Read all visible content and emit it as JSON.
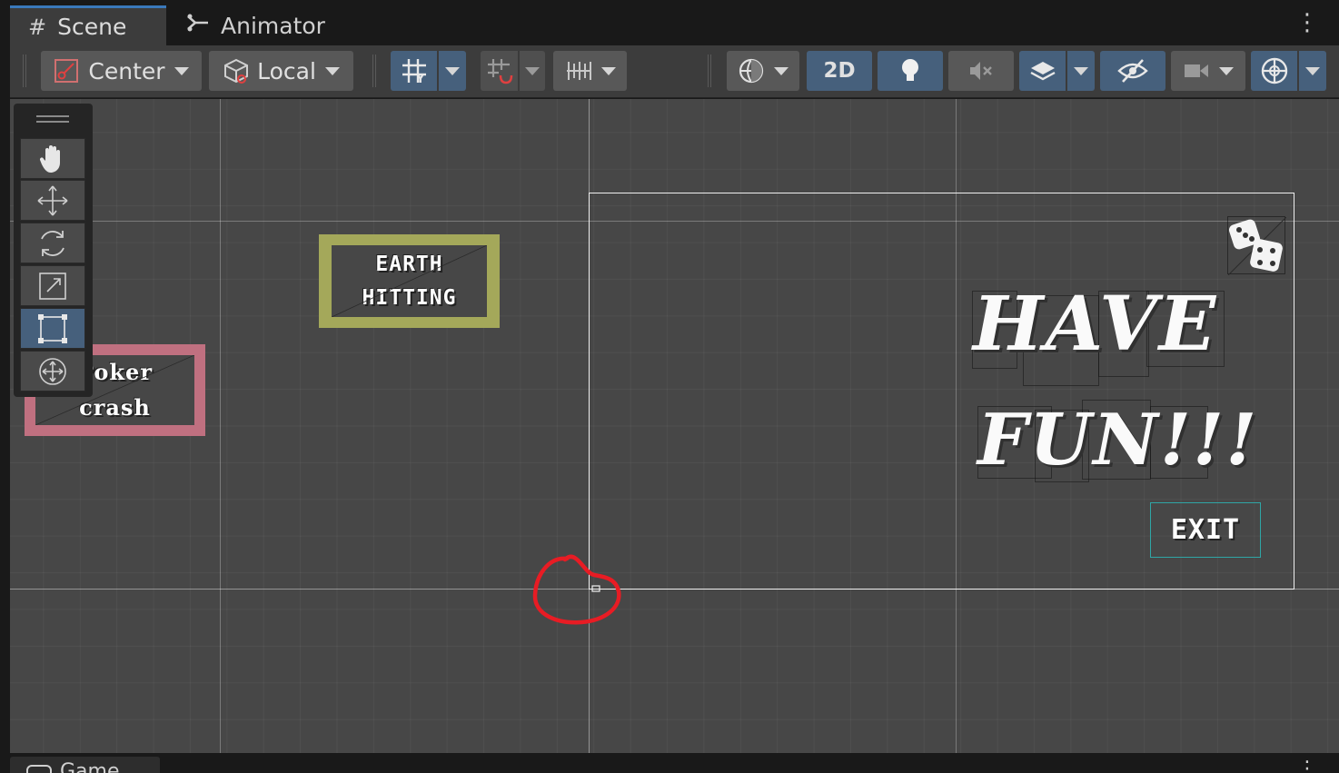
{
  "tabs": {
    "scene_label": "Scene",
    "animator_label": "Animator",
    "game_label": "Game",
    "menu_icon": "⋮"
  },
  "toolbar": {
    "pivot_label": "Center",
    "space_label": "Local",
    "mode_2d_label": "2D"
  },
  "tools": [
    {
      "name": "hand-tool",
      "icon": "hand-icon"
    },
    {
      "name": "move-tool",
      "icon": "move-arrows-icon"
    },
    {
      "name": "rotate-tool",
      "icon": "rotate-icon"
    },
    {
      "name": "scale-tool",
      "icon": "scale-icon"
    },
    {
      "name": "rect-tool",
      "icon": "rect-transform-icon",
      "selected": true
    },
    {
      "name": "transform-tool",
      "icon": "transform-icon"
    }
  ],
  "scene": {
    "earth_hitting_lines": [
      "EARTH",
      "HITTING"
    ],
    "poker_crash_lines": [
      "Poker",
      "crash"
    ],
    "have_text": "HAVE",
    "fun_text": "FUN!!!",
    "exit_text": "EXIT"
  },
  "colors": {
    "accent_blue": "#46607c",
    "earth_button_border": "#a4a85a",
    "poker_button_border": "#c07080",
    "exit_outline": "#2fa6a6",
    "annotation_red": "#e81c24"
  }
}
